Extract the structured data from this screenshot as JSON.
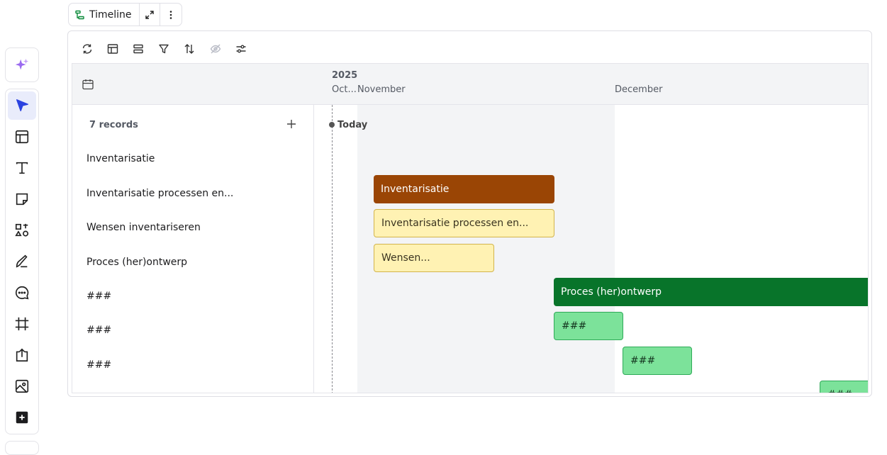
{
  "widget": {
    "title": "Timeline"
  },
  "timeline": {
    "year": "2025",
    "months": [
      "Oct...",
      "November",
      "December"
    ],
    "record_count": "7 records",
    "today_label": "Today",
    "rows": [
      {
        "label": "Inventarisatie",
        "bar_label": "Inventarisatie"
      },
      {
        "label": "Inventarisatie processen en...",
        "bar_label": "Inventarisatie processen en..."
      },
      {
        "label": "Wensen inventariseren",
        "bar_label": "Wensen..."
      },
      {
        "label": "Proces (her)ontwerp",
        "bar_label": "Proces (her)ontwerp"
      },
      {
        "label": "###",
        "bar_label": "###"
      },
      {
        "label": "###",
        "bar_label": "###"
      },
      {
        "label": "###",
        "bar_label": "###"
      }
    ]
  },
  "colors": {
    "accent": "#2b43e0",
    "brown_bar": "#9a4505",
    "yellow_bar": "#fff2b3",
    "dark_green_bar": "#08742a",
    "light_green_bar": "#7ce29a"
  },
  "icons": {
    "left_toolbar": [
      "sparkle-icon",
      "select-arrow-icon",
      "layout-icon",
      "text-icon",
      "sticky-note-icon",
      "shapes-icon",
      "pen-icon",
      "comment-icon",
      "frame-icon",
      "upload-icon",
      "image-icon",
      "add-icon"
    ],
    "toolbar": [
      "refresh-icon",
      "table-icon",
      "group-icon",
      "filter-icon",
      "sort-icon",
      "hide-icon",
      "settings-sliders-icon"
    ]
  }
}
